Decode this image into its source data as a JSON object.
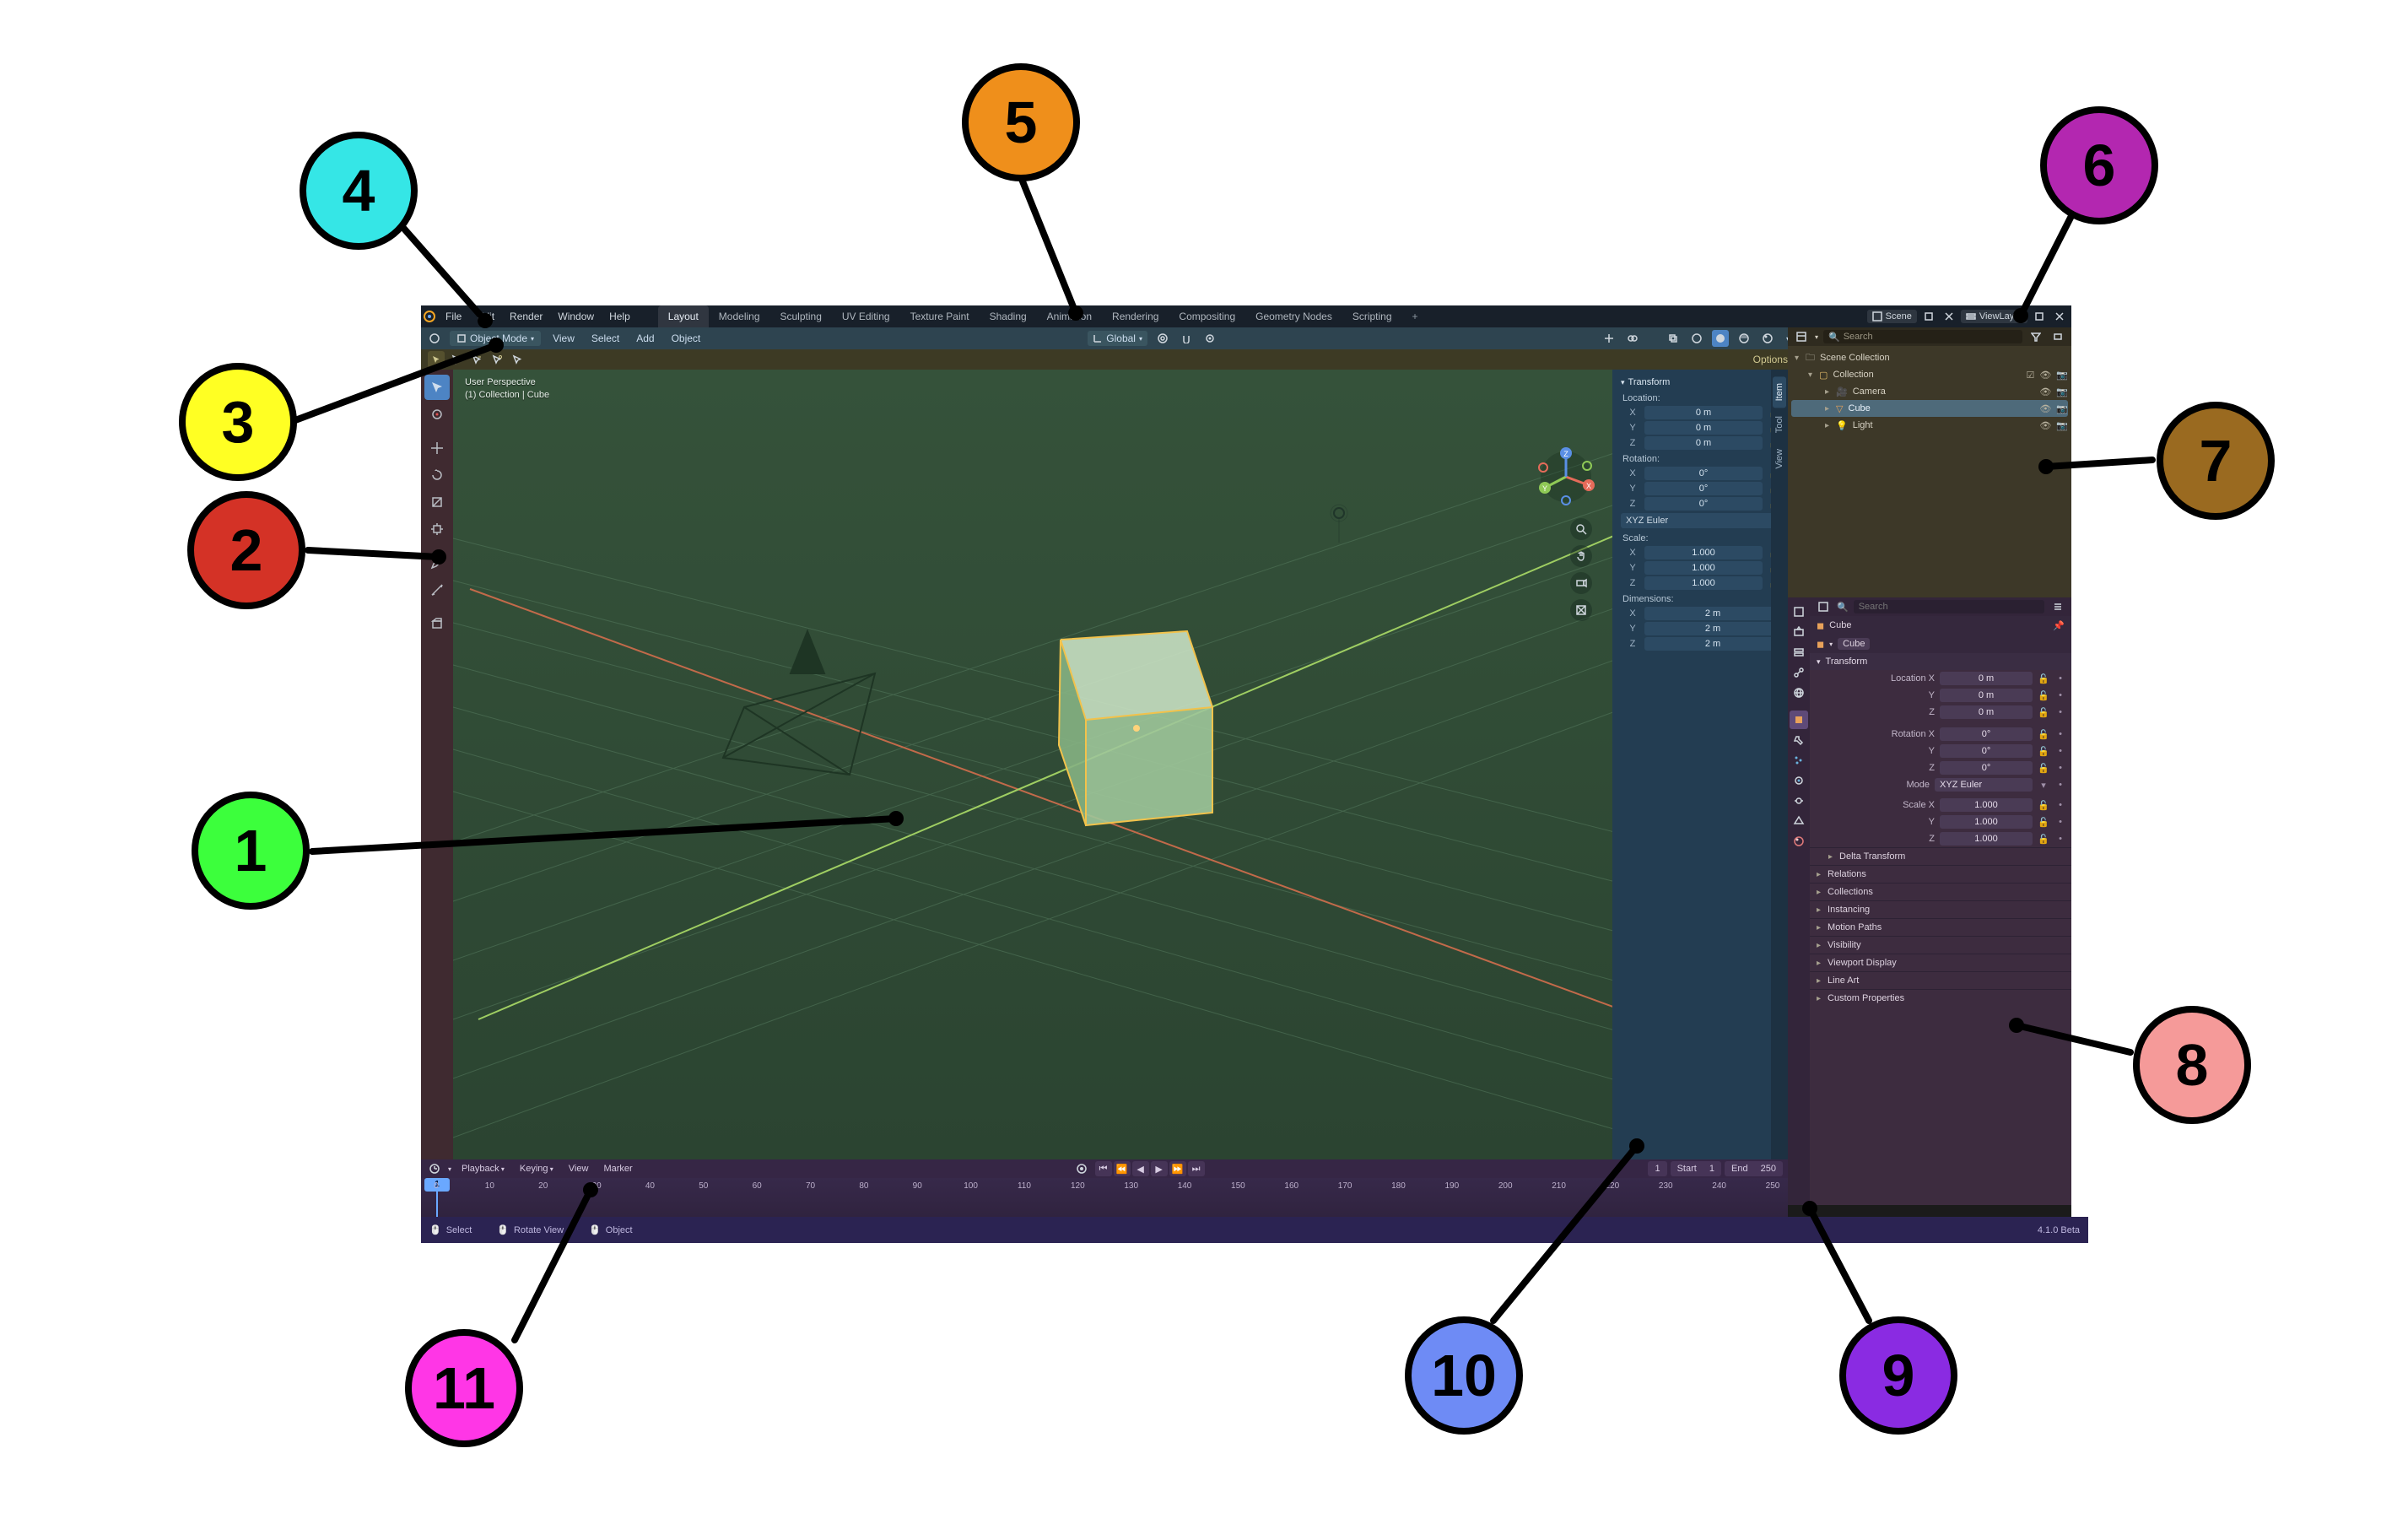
{
  "annotations": {
    "1": "1",
    "2": "2",
    "3": "3",
    "4": "4",
    "5": "5",
    "6": "6",
    "7": "7",
    "8": "8",
    "9": "9",
    "10": "10",
    "11": "11"
  },
  "topbar": {
    "menus": [
      "File",
      "Edit",
      "Render",
      "Window",
      "Help"
    ],
    "workspaces": [
      "Layout",
      "Modeling",
      "Sculpting",
      "UV Editing",
      "Texture Paint",
      "Shading",
      "Animation",
      "Rendering",
      "Compositing",
      "Geometry Nodes",
      "Scripting"
    ],
    "active_workspace": "Layout",
    "scene_label": "Scene",
    "viewlayer_label": "ViewLayer"
  },
  "v3d_header": {
    "mode": "Object Mode",
    "menus": [
      "View",
      "Select",
      "Add",
      "Object"
    ],
    "orientation": "Global",
    "options_label": "Options"
  },
  "viewport_info": {
    "line1": "User Perspective",
    "line2": "(1) Collection | Cube"
  },
  "toolbar_tools": [
    "select-box",
    "cursor",
    "move",
    "rotate",
    "scale",
    "transform",
    "annotate",
    "measure",
    "add-cube"
  ],
  "navball_axes": {
    "x": "X",
    "y": "Y",
    "z": "Z"
  },
  "npanel": {
    "tabs": [
      "Item",
      "Tool",
      "View"
    ],
    "active_tab": "Item",
    "transform_label": "Transform",
    "location_label": "Location:",
    "rotation_label": "Rotation:",
    "rotation_mode_label": "XYZ Euler",
    "scale_label": "Scale:",
    "dimensions_label": "Dimensions:",
    "location": {
      "X": "0 m",
      "Y": "0 m",
      "Z": "0 m"
    },
    "rotation": {
      "X": "0°",
      "Y": "0°",
      "Z": "0°"
    },
    "scale": {
      "X": "1.000",
      "Y": "1.000",
      "Z": "1.000"
    },
    "dimensions": {
      "X": "2 m",
      "Y": "2 m",
      "Z": "2 m"
    }
  },
  "outliner": {
    "search_placeholder": "Search",
    "root": "Scene Collection",
    "collection": "Collection",
    "items": [
      "Camera",
      "Cube",
      "Light"
    ],
    "selected": "Cube"
  },
  "props": {
    "search_placeholder": "Search",
    "crumb_object": "Cube",
    "crumb_data": "Cube",
    "transform_label": "Transform",
    "rows": {
      "location_x_label": "Location X",
      "y_label": "Y",
      "z_label": "Z",
      "rotation_x_label": "Rotation X",
      "mode_label": "Mode",
      "mode_value": "XYZ Euler",
      "scale_x_label": "Scale X"
    },
    "location": {
      "X": "0 m",
      "Y": "0 m",
      "Z": "0 m"
    },
    "rotation": {
      "X": "0°",
      "Y": "0°",
      "Z": "0°"
    },
    "scale": {
      "X": "1.000",
      "Y": "1.000",
      "Z": "1.000"
    },
    "collapsed": [
      "Delta Transform",
      "Relations",
      "Collections",
      "Instancing",
      "Motion Paths",
      "Visibility",
      "Viewport Display",
      "Line Art",
      "Custom Properties"
    ]
  },
  "timeline": {
    "menus": [
      "Playback",
      "Keying",
      "View",
      "Marker"
    ],
    "start_label": "Start",
    "start_value": "1",
    "end_label": "End",
    "end_value": "250",
    "current_frame": "1",
    "ticks": [
      "0",
      "10",
      "20",
      "30",
      "40",
      "50",
      "60",
      "70",
      "80",
      "90",
      "100",
      "110",
      "120",
      "130",
      "140",
      "150",
      "160",
      "170",
      "180",
      "190",
      "200",
      "210",
      "220",
      "230",
      "240",
      "250"
    ]
  },
  "status": {
    "select": "Select",
    "rotate": "Rotate View",
    "object": "Object",
    "version": "4.1.0 Beta"
  }
}
